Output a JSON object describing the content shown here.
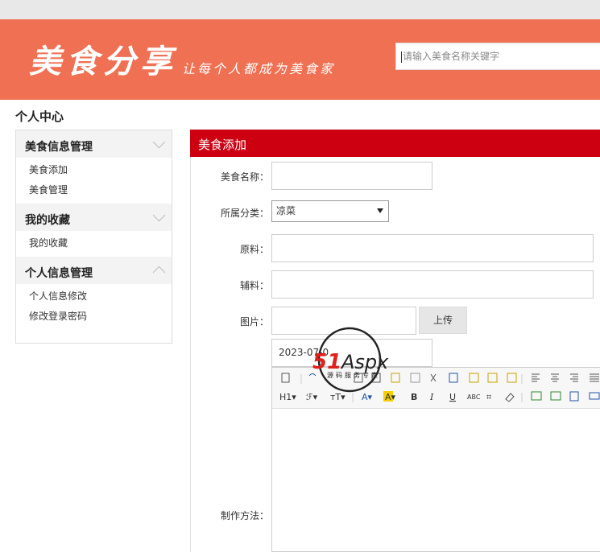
{
  "header": {
    "logo": "美食分享",
    "slogan": "让每个人都成为美食家",
    "search_placeholder": "请输入美食名称关键字"
  },
  "page_title": "个人中心",
  "sidebar": {
    "groups": [
      {
        "title": "美食信息管理",
        "expanded": true,
        "items": [
          "美食添加",
          "美食管理"
        ]
      },
      {
        "title": "我的收藏",
        "expanded": true,
        "items": [
          "我的收藏"
        ]
      },
      {
        "title": "个人信息管理",
        "expanded": false,
        "items": [
          "个人信息修改",
          "修改登录密码"
        ]
      }
    ]
  },
  "form": {
    "title": "美食添加",
    "fields": {
      "name_label": "美食名称：",
      "category_label": "所属分类：",
      "category_value": "凉菜",
      "ingredients_label": "原料：",
      "accessories_label": "辅料：",
      "image_label": "图片：",
      "upload_label": "上传",
      "date_value": "2023-07-0",
      "method_label": "制作方法："
    }
  },
  "watermark": {
    "brand": "51Aspx",
    "sub": "源码服务专家"
  },
  "colors": {
    "banner": "#f07053",
    "form_header": "#cc0011"
  }
}
